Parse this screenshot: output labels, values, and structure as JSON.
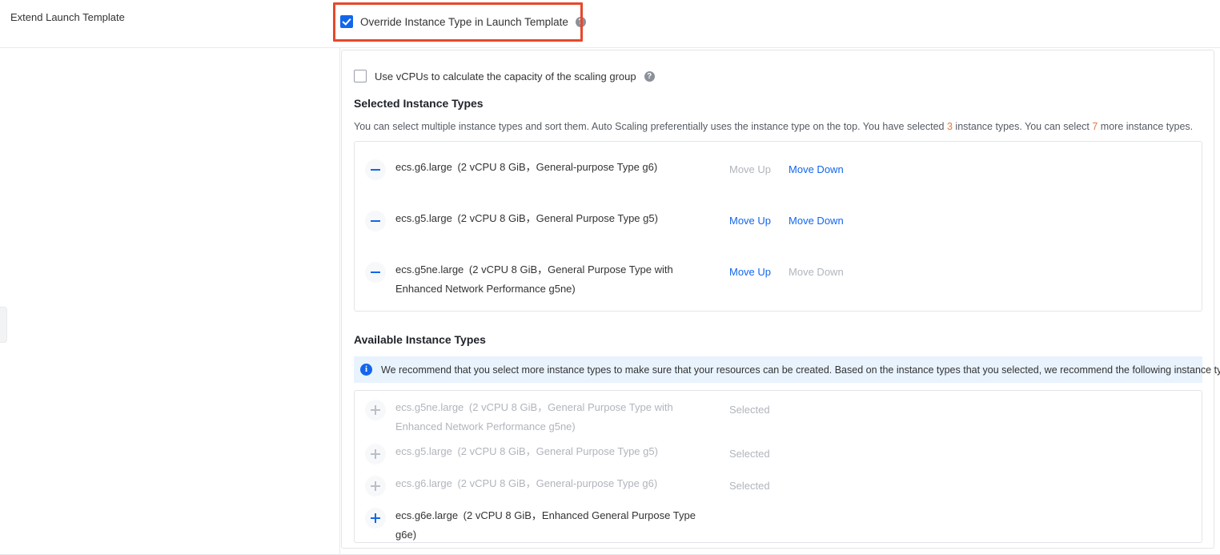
{
  "form": {
    "field_label": "Extend Launch Template",
    "override_checkbox": {
      "label": "Override Instance Type in Launch Template",
      "checked": true,
      "help_icon": "?"
    },
    "vcpu_checkbox": {
      "label": "Use vCPUs to calculate the capacity of the scaling group",
      "checked": false,
      "help_icon": "?"
    }
  },
  "selected_section": {
    "title": "Selected Instance Types",
    "description_part1": "You can select multiple instance types and sort them. Auto Scaling preferentially uses the instance type on the top. You have selected ",
    "selected_count": "3",
    "description_part2": " instance types. You can select ",
    "remaining_count": "7",
    "description_part3": " more instance types.",
    "rows": [
      {
        "name": "ecs.g6.large",
        "spec": "(2 vCPU 8 GiB，General-purpose Type g6)",
        "move_up": "Move Up",
        "move_down": "Move Down",
        "move_up_enabled": false,
        "move_down_enabled": true,
        "icon": "minus-circle-icon"
      },
      {
        "name": "ecs.g5.large",
        "spec": "(2 vCPU 8 GiB，General Purpose Type g5)",
        "move_up": "Move Up",
        "move_down": "Move Down",
        "move_up_enabled": true,
        "move_down_enabled": true,
        "icon": "minus-circle-icon"
      },
      {
        "name": "ecs.g5ne.large",
        "spec": "(2 vCPU 8 GiB，General Purpose Type with Enhanced Network Performance g5ne)",
        "move_up": "Move Up",
        "move_down": "Move Down",
        "move_up_enabled": true,
        "move_down_enabled": false,
        "icon": "minus-circle-icon"
      }
    ]
  },
  "available_section": {
    "title": "Available Instance Types",
    "banner": {
      "icon": "info-icon",
      "text": "We recommend that you select more instance types to make sure that your resources can be created. Based on the instance types that you selected, we recommend the following instance types:"
    },
    "rows": [
      {
        "name": "ecs.g5ne.large",
        "spec": "(2 vCPU 8 GiB，General Purpose Type with Enhanced Network Performance g5ne)",
        "status": "Selected",
        "disabled": true,
        "icon": "plus-circle-icon"
      },
      {
        "name": "ecs.g5.large",
        "spec": "(2 vCPU 8 GiB，General Purpose Type g5)",
        "status": "Selected",
        "disabled": true,
        "icon": "plus-circle-icon"
      },
      {
        "name": "ecs.g6.large",
        "spec": "(2 vCPU 8 GiB，General-purpose Type g6)",
        "status": "Selected",
        "disabled": true,
        "icon": "plus-circle-icon"
      },
      {
        "name": "ecs.g6e.large",
        "spec": "(2 vCPU 8 GiB，Enhanced General Purpose Type g6e)",
        "status": "",
        "disabled": false,
        "icon": "plus-circle-icon"
      }
    ]
  },
  "colors": {
    "accent": "#1366ec",
    "highlight_box": "#e8472b",
    "warning_number": "#e8763b",
    "banner_bg": "#e8f3fe",
    "disabled_text": "#b0b5bc"
  }
}
